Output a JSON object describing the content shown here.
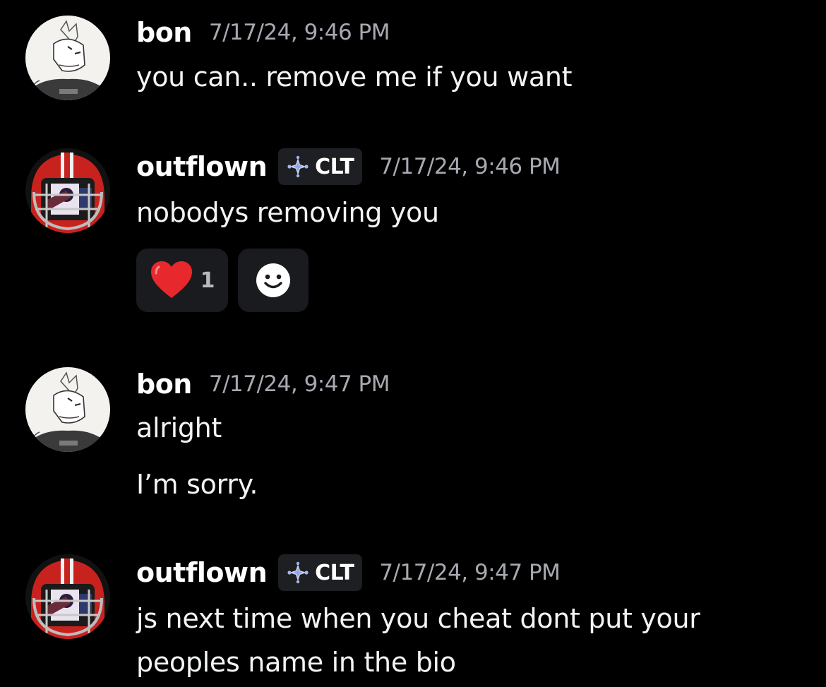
{
  "colors": {
    "background": "#000000",
    "message_text": "#f2f3f5",
    "timestamp": "#a6a9b0",
    "tag_background": "#1e1f22",
    "reaction_background": "#1a1b1e"
  },
  "messages": [
    {
      "username": "bon",
      "timestamp": "7/17/24, 9:46 PM",
      "lines": [
        "you can.. remove me if you want"
      ],
      "avatar": "sketch-character-avatar"
    },
    {
      "username": "outflown",
      "tag": {
        "icon": "sparkle-diamond-icon",
        "label": "CLT"
      },
      "timestamp": "7/17/24, 9:46 PM",
      "lines": [
        "nobodys removing you"
      ],
      "avatar": "football-helmet-avatar",
      "reactions": [
        {
          "emoji": "heart-emoji",
          "count": "1"
        },
        {
          "emoji": "add-reaction-smiley-icon"
        }
      ]
    },
    {
      "username": "bon",
      "timestamp": "7/17/24, 9:47 PM",
      "lines": [
        "alright",
        "I’m sorry."
      ],
      "avatar": "sketch-character-avatar"
    },
    {
      "username": "outflown",
      "tag": {
        "icon": "sparkle-diamond-icon",
        "label": "CLT"
      },
      "timestamp": "7/17/24, 9:47 PM",
      "lines": [
        "js next time when you cheat dont put your",
        "peoples name in the bio"
      ],
      "avatar": "football-helmet-avatar"
    }
  ]
}
